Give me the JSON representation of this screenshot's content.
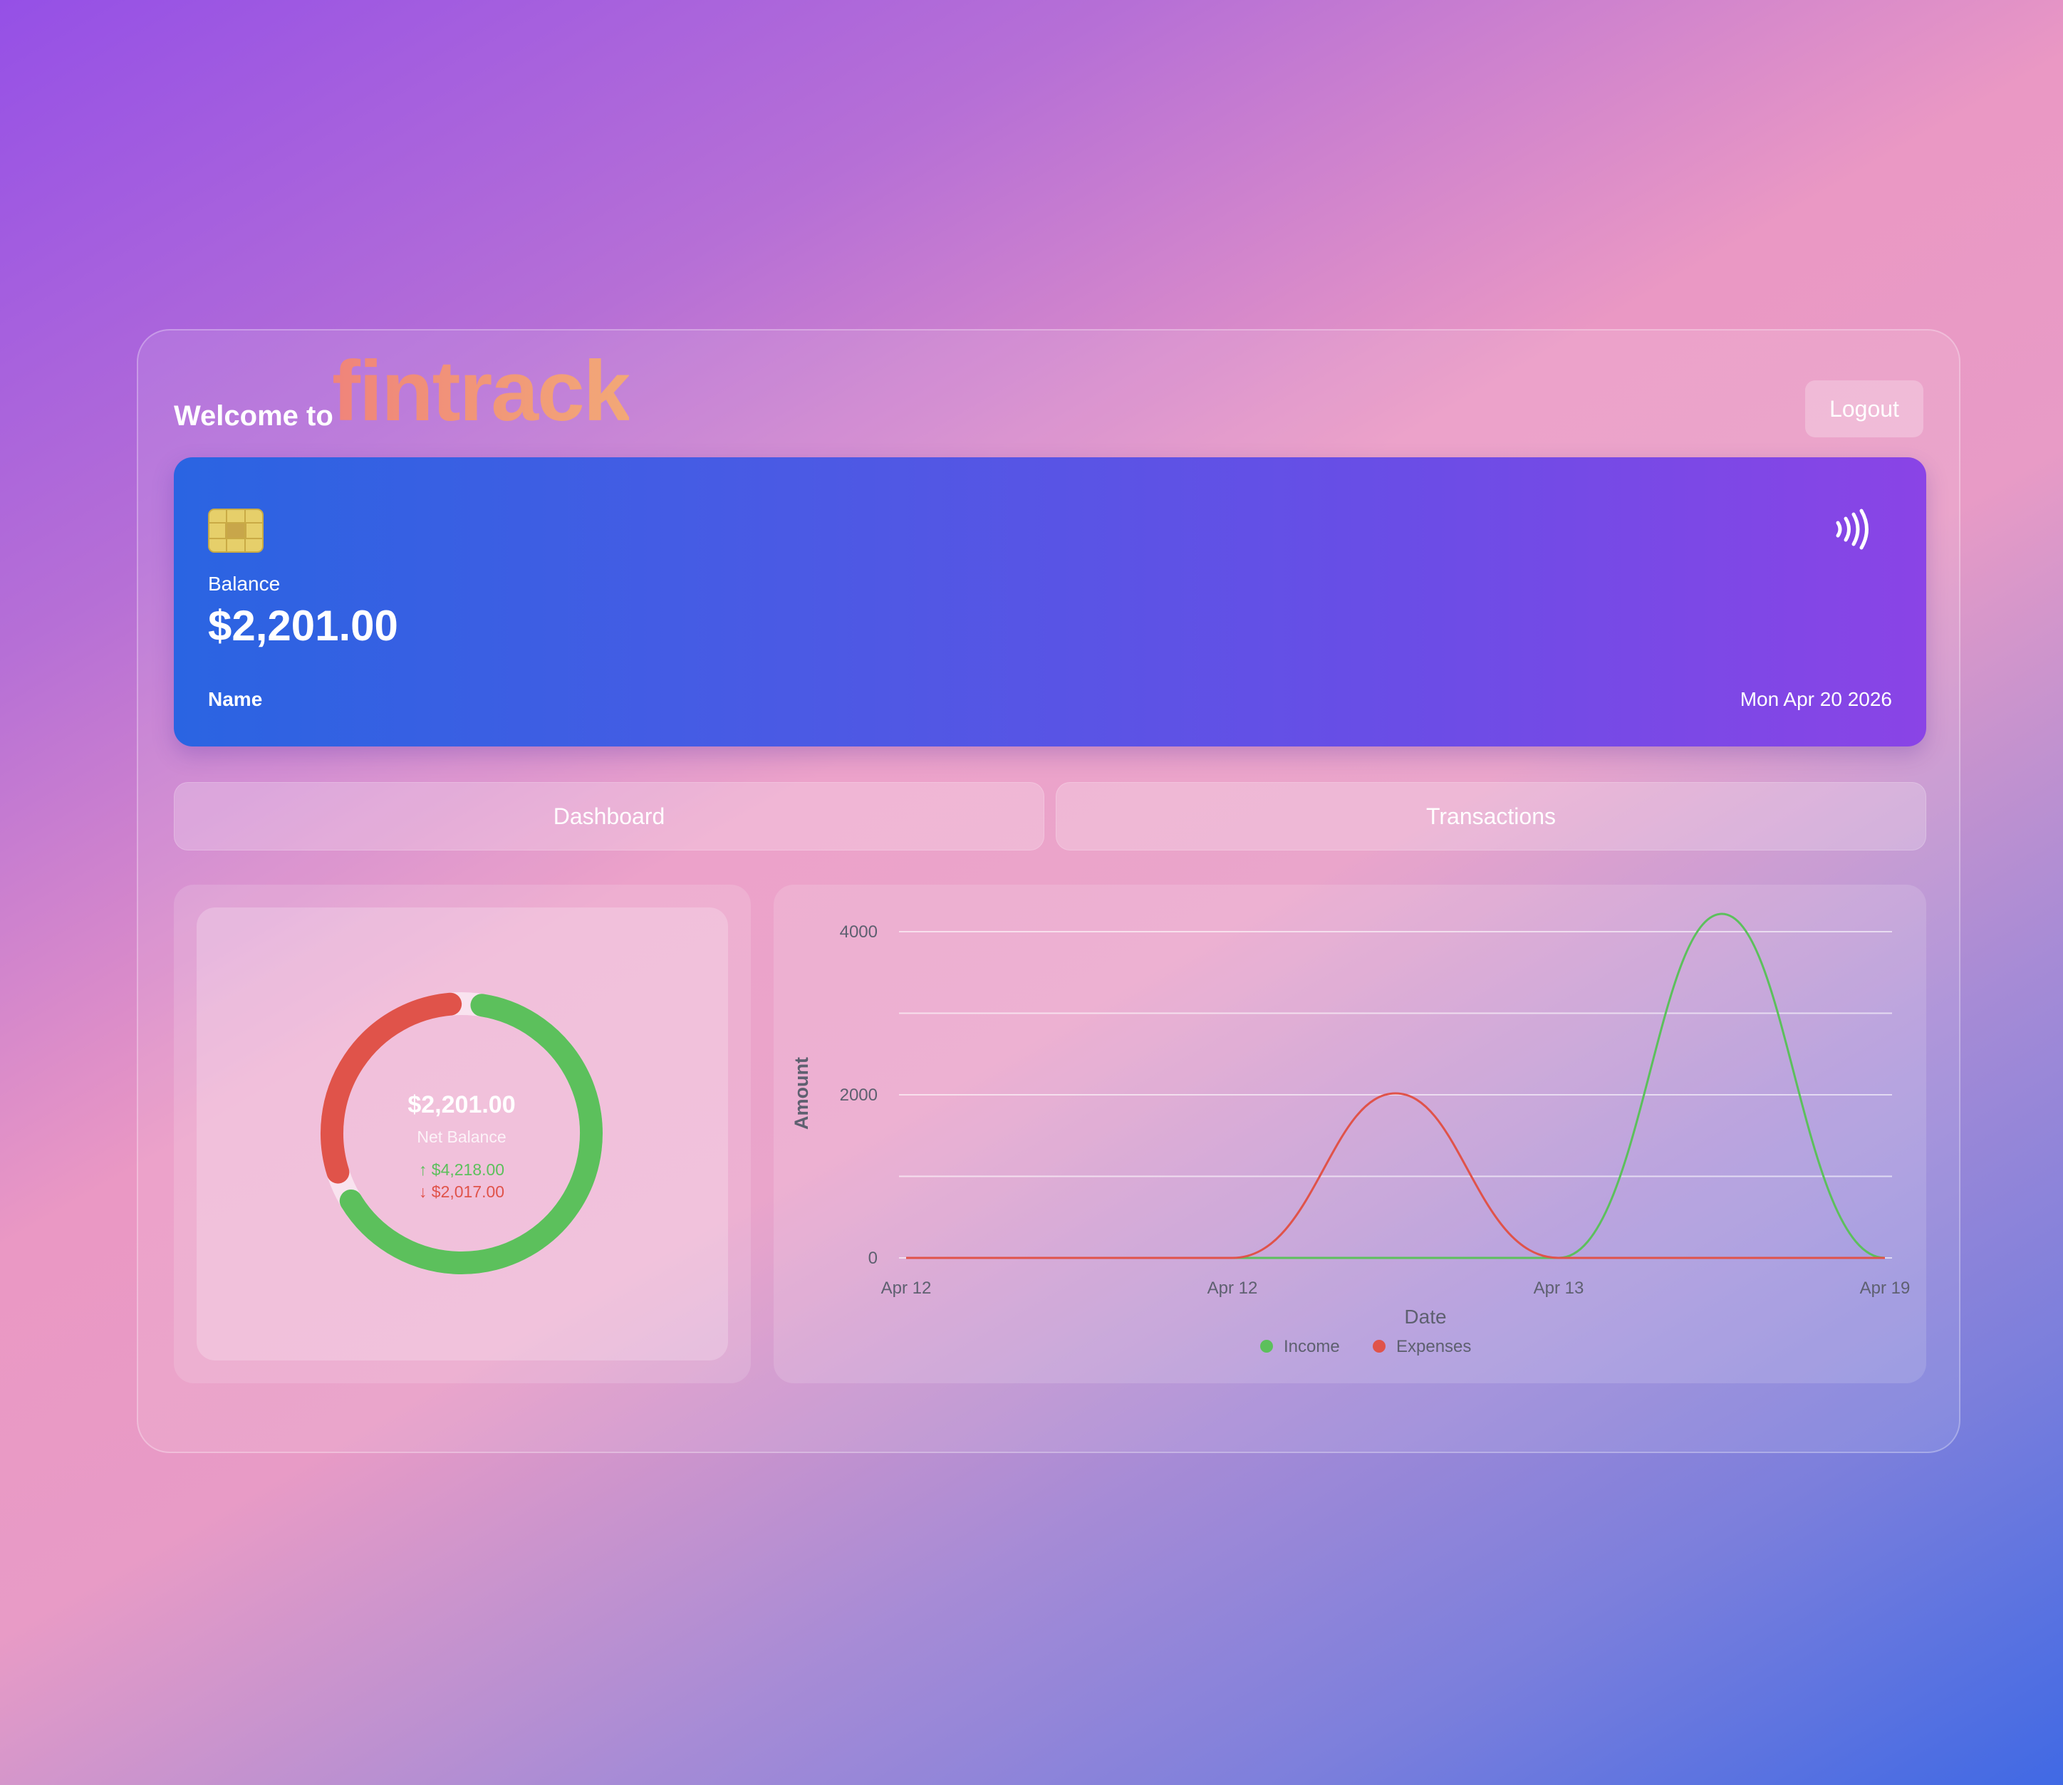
{
  "header": {
    "welcome": "Welcome to",
    "brand": "fintrack",
    "logout_label": "Logout"
  },
  "card": {
    "balance_label": "Balance",
    "balance_value": "$2,201.00",
    "name": "Name",
    "date": "Mon Apr 20 2026",
    "chip_icon": "card-chip-icon",
    "contactless_icon": "contactless-icon"
  },
  "tabs": [
    {
      "label": "Dashboard"
    },
    {
      "label": "Transactions"
    }
  ],
  "donut": {
    "center_value": "$2,201.00",
    "center_label": "Net Balance",
    "income_text": "↑ $4,218.00",
    "expense_text": "↓ $2,017.00"
  },
  "colors": {
    "income": "#5cc05c",
    "expense": "#e0534a",
    "accent": "#f0847a"
  },
  "chart_data": [
    {
      "type": "pie",
      "categories": [
        "Income",
        "Expenses"
      ],
      "values": [
        4218,
        2017
      ]
    },
    {
      "type": "line",
      "xlabel": "Date",
      "ylabel": "Amount",
      "categories": [
        "Apr 12",
        "Apr 12",
        "Apr 13",
        "Apr 19"
      ],
      "ylim": [
        0,
        4000
      ],
      "yticks": [
        0,
        2000,
        4000
      ],
      "grid": true,
      "legend": "bottom",
      "series": [
        {
          "name": "Income",
          "color": "#5cc05c",
          "values": [
            0,
            0,
            0,
            4218
          ]
        },
        {
          "name": "Expenses",
          "color": "#e0534a",
          "values": [
            0,
            0,
            2017,
            0
          ]
        }
      ]
    }
  ]
}
